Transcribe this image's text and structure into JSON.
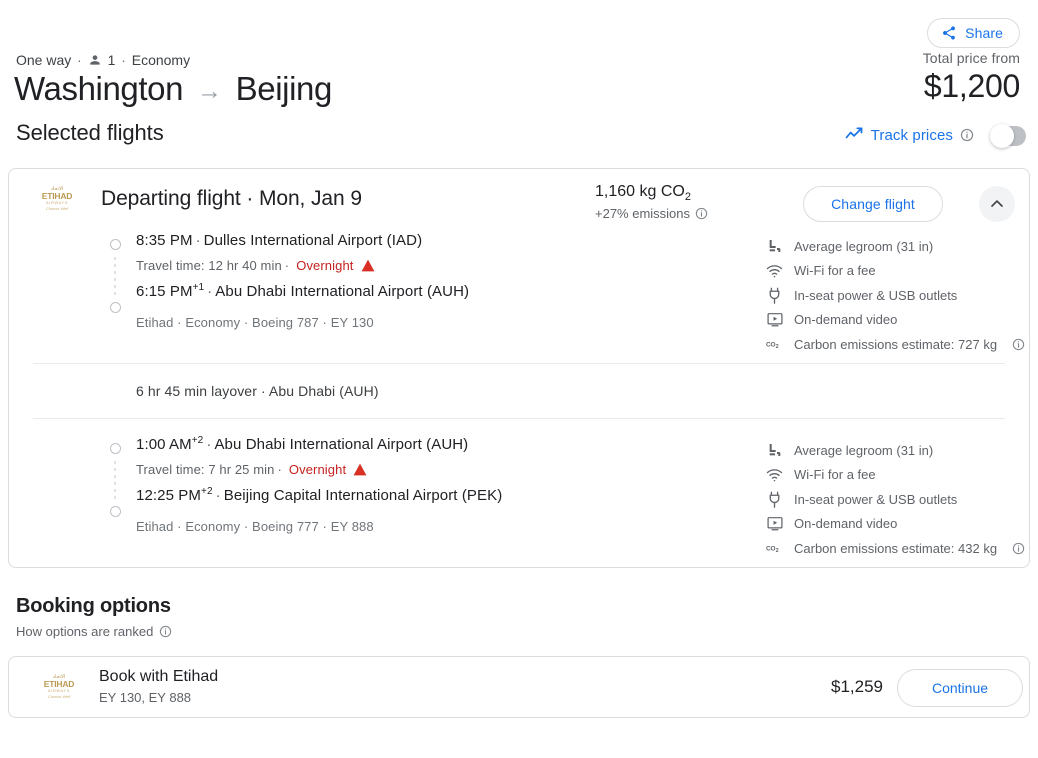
{
  "header": {
    "share_label": "Share",
    "share_icon": "share-icon",
    "trip_type": "One way",
    "passenger_icon": "person-icon",
    "passengers": "1",
    "cabin": "Economy",
    "origin": "Washington",
    "arrow": "→",
    "destination": "Beijing",
    "total_price_label": "Total price from",
    "total_price": "$1,200"
  },
  "selected_flights": {
    "title": "Selected flights",
    "track_prices_label": "Track prices",
    "track_prices_icon": "trending-up-icon",
    "track_prices_info_icon": "info-icon",
    "toggle_state": "off"
  },
  "flight_card": {
    "airline_logo": {
      "arabic": "الاتحاد",
      "name": "ETIHAD",
      "sub": "AIRWAYS",
      "tagline": "Choose Well"
    },
    "title": "Departing flight · Mon, Jan 9",
    "emissions_total": "1,160 kg CO",
    "emissions_sub_digit": "2",
    "emissions_delta": "+27% emissions",
    "emissions_info_icon": "info-icon",
    "change_flight_label": "Change flight",
    "collapse_icon": "chevron-up-icon",
    "legs": [
      {
        "depart_time": "8:35 PM",
        "depart_day_offset": "",
        "depart_airport": "Dulles International Airport (IAD)",
        "travel_time": "Travel time: 12 hr 40 min",
        "overnight_label": "Overnight",
        "overnight_icon": "warning-triangle-icon",
        "arrive_time": "6:15 PM",
        "arrive_day_offset": "+1",
        "arrive_airport": "Abu Dhabi International Airport (AUH)",
        "details": "Etihad · Economy · Boeing 787 · EY 130",
        "amenities": [
          {
            "icon": "legroom-icon",
            "label": "Average legroom (31 in)",
            "info": false
          },
          {
            "icon": "wifi-icon",
            "label": "Wi-Fi for a fee",
            "info": false
          },
          {
            "icon": "power-plug-icon",
            "label": "In-seat power & USB outlets",
            "info": false
          },
          {
            "icon": "video-icon",
            "label": "On-demand video",
            "info": false
          },
          {
            "icon": "co2-icon",
            "label": "Carbon emissions estimate: 727 kg",
            "info": true
          }
        ]
      },
      {
        "depart_time": "1:00 AM",
        "depart_day_offset": "+2",
        "depart_airport": "Abu Dhabi International Airport (AUH)",
        "travel_time": "Travel time: 7 hr 25 min",
        "overnight_label": "Overnight",
        "overnight_icon": "warning-triangle-icon",
        "arrive_time": "12:25 PM",
        "arrive_day_offset": "+2",
        "arrive_airport": "Beijing Capital International Airport (PEK)",
        "details": "Etihad · Economy · Boeing 777 · EY 888",
        "amenities": [
          {
            "icon": "legroom-icon",
            "label": "Average legroom (31 in)",
            "info": false
          },
          {
            "icon": "wifi-icon",
            "label": "Wi-Fi for a fee",
            "info": false
          },
          {
            "icon": "power-plug-icon",
            "label": "In-seat power & USB outlets",
            "info": false
          },
          {
            "icon": "video-icon",
            "label": "On-demand video",
            "info": false
          },
          {
            "icon": "co2-icon",
            "label": "Carbon emissions estimate: 432 kg",
            "info": true
          }
        ]
      }
    ],
    "layover": "6 hr 45 min layover · Abu Dhabi (AUH)"
  },
  "booking_options": {
    "title": "Booking options",
    "ranked_label": "How options are ranked",
    "ranked_info_icon": "info-icon",
    "rows": [
      {
        "title": "Book with Etihad",
        "subtitle": "EY 130, EY 888",
        "price": "$1,259",
        "cta": "Continue"
      }
    ]
  },
  "colors": {
    "accent_blue": "#1a73e8",
    "warning_red": "#c5221f",
    "etihad_gold": "#b99a52",
    "border_gray": "#dadce0",
    "text_secondary": "#5f6368"
  }
}
